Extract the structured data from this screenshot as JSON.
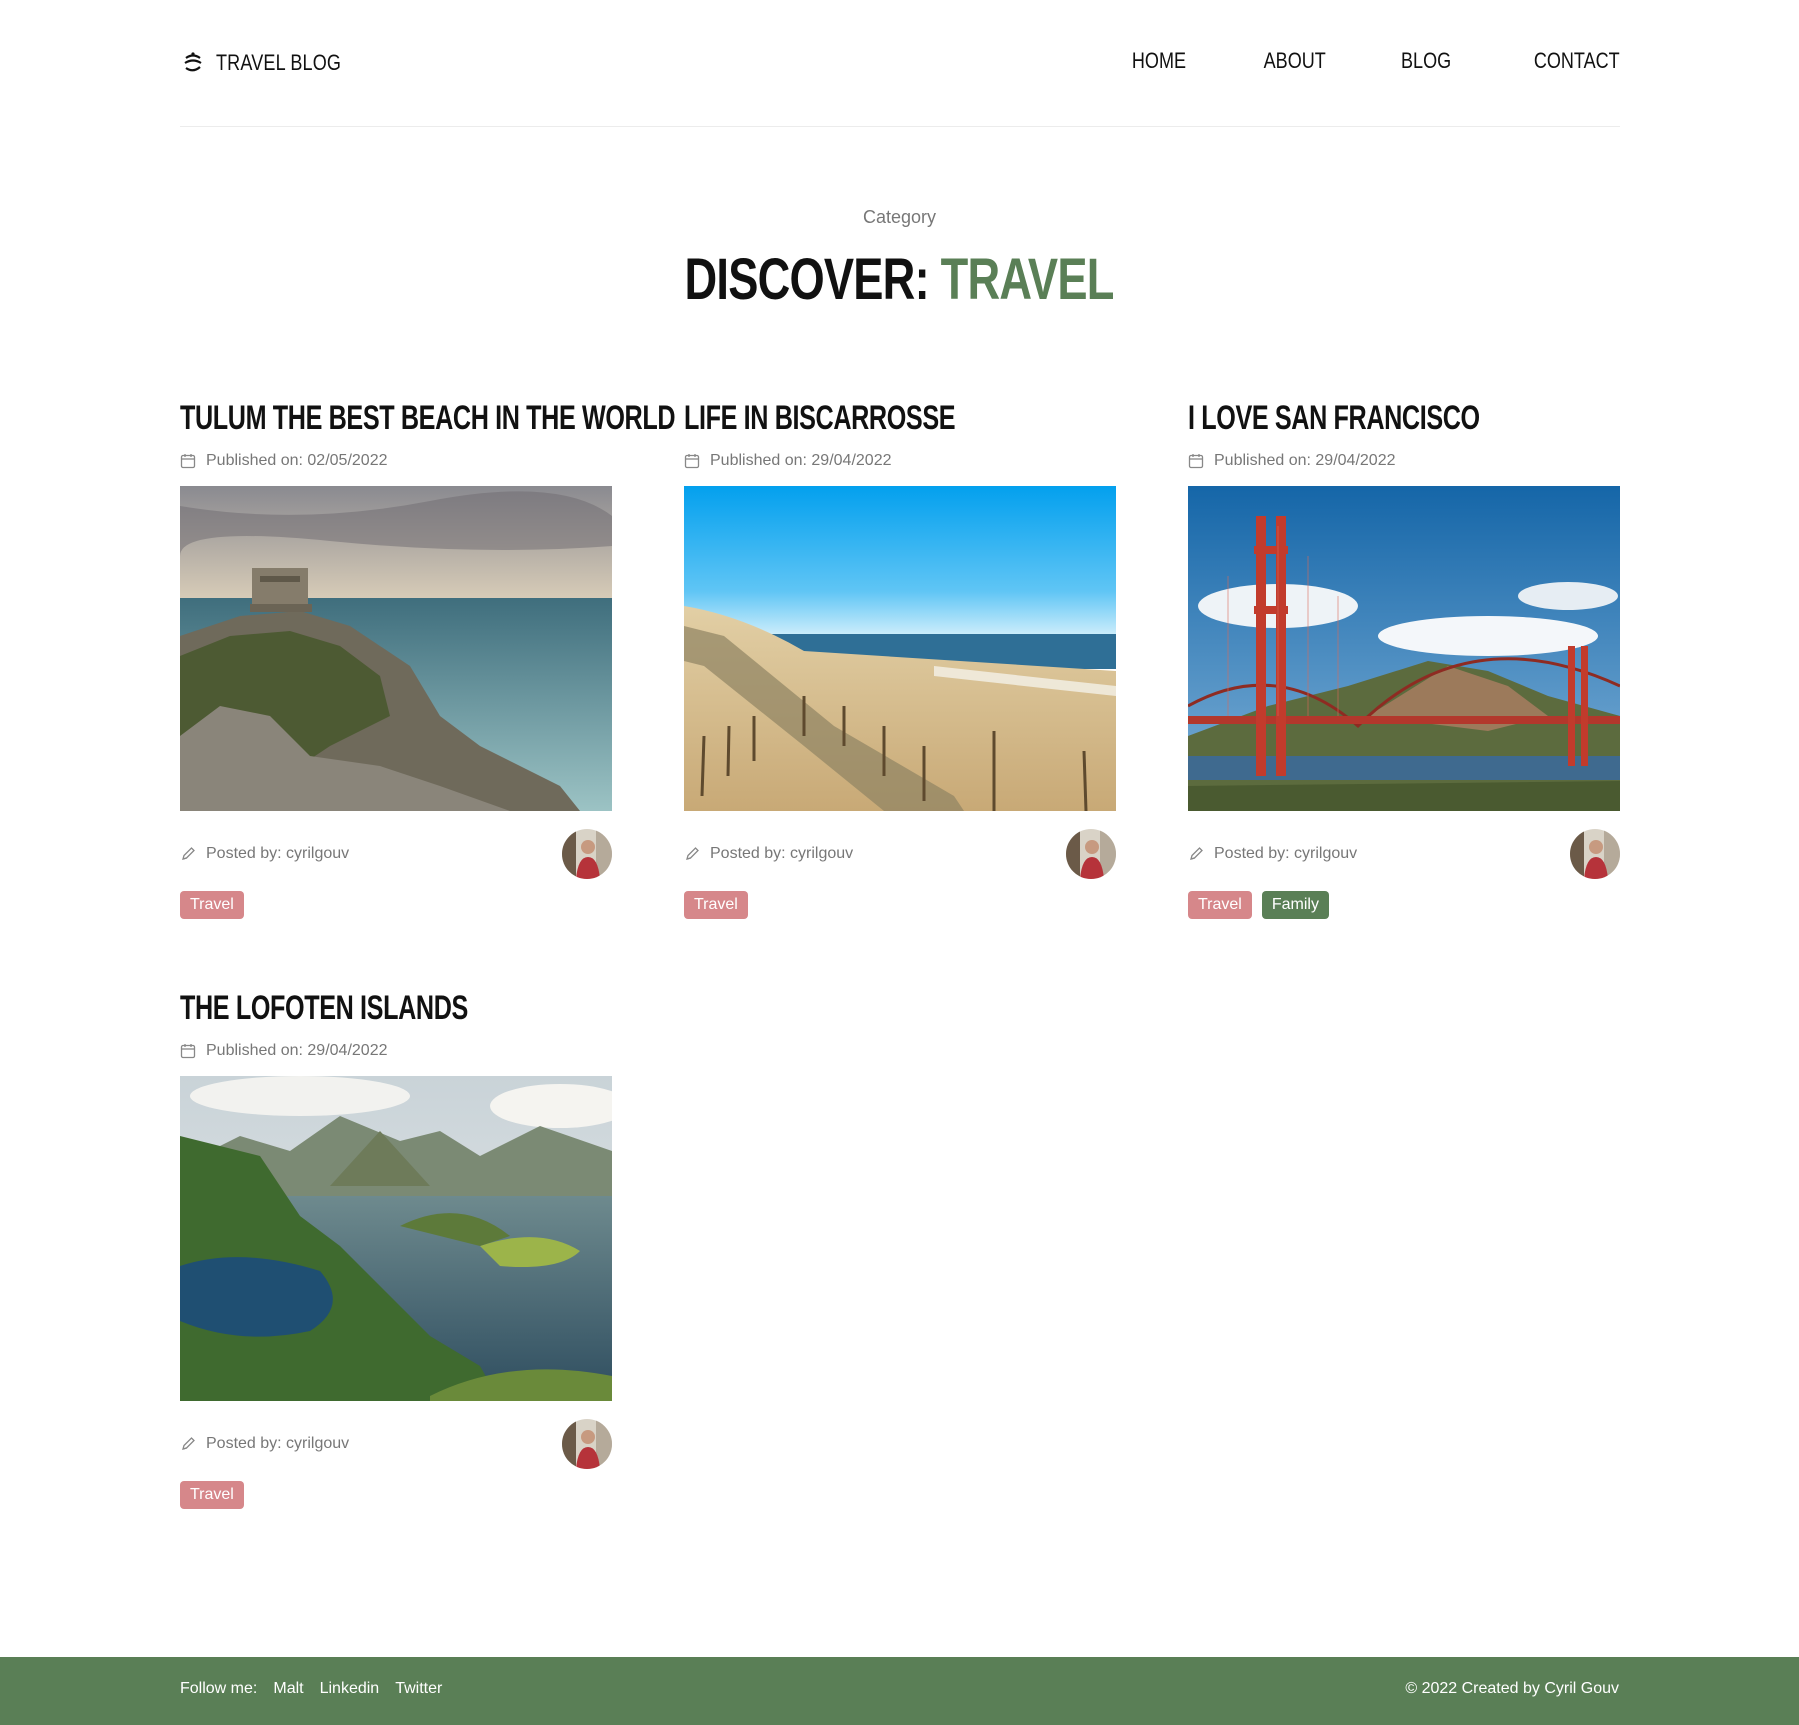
{
  "header": {
    "logo_text": "TRAVEL BLOG",
    "nav": [
      "HOME",
      "ABOUT",
      "BLOG",
      "CONTACT"
    ]
  },
  "hero": {
    "category_label": "Category",
    "title_prefix": "DISCOVER:",
    "title_accent": "TRAVEL"
  },
  "posts": [
    {
      "title": "TULUM THE BEST BEACH IN THE WORLD",
      "published": "Published on: 02/05/2022",
      "author": "Posted by: cyrilgouv",
      "tags": [
        "Travel"
      ]
    },
    {
      "title": "LIFE IN BISCARROSSE",
      "published": "Published on: 29/04/2022",
      "author": "Posted by: cyrilgouv",
      "tags": [
        "Travel"
      ]
    },
    {
      "title": "I LOVE SAN FRANCISCO",
      "published": "Published on: 29/04/2022",
      "author": "Posted by: cyrilgouv",
      "tags": [
        "Travel",
        "Family"
      ]
    },
    {
      "title": "THE LOFOTEN ISLANDS",
      "published": "Published on: 29/04/2022",
      "author": "Posted by: cyrilgouv",
      "tags": [
        "Travel"
      ]
    }
  ],
  "footer": {
    "follow_label": "Follow me:",
    "links": [
      "Malt",
      "Linkedin",
      "Twitter"
    ],
    "copyright": "© 2022 Created by Cyril Gouv"
  },
  "colors": {
    "accent_green": "#5a7f56",
    "tag_travel": "#d6878a",
    "tag_family": "#5a7f56"
  }
}
